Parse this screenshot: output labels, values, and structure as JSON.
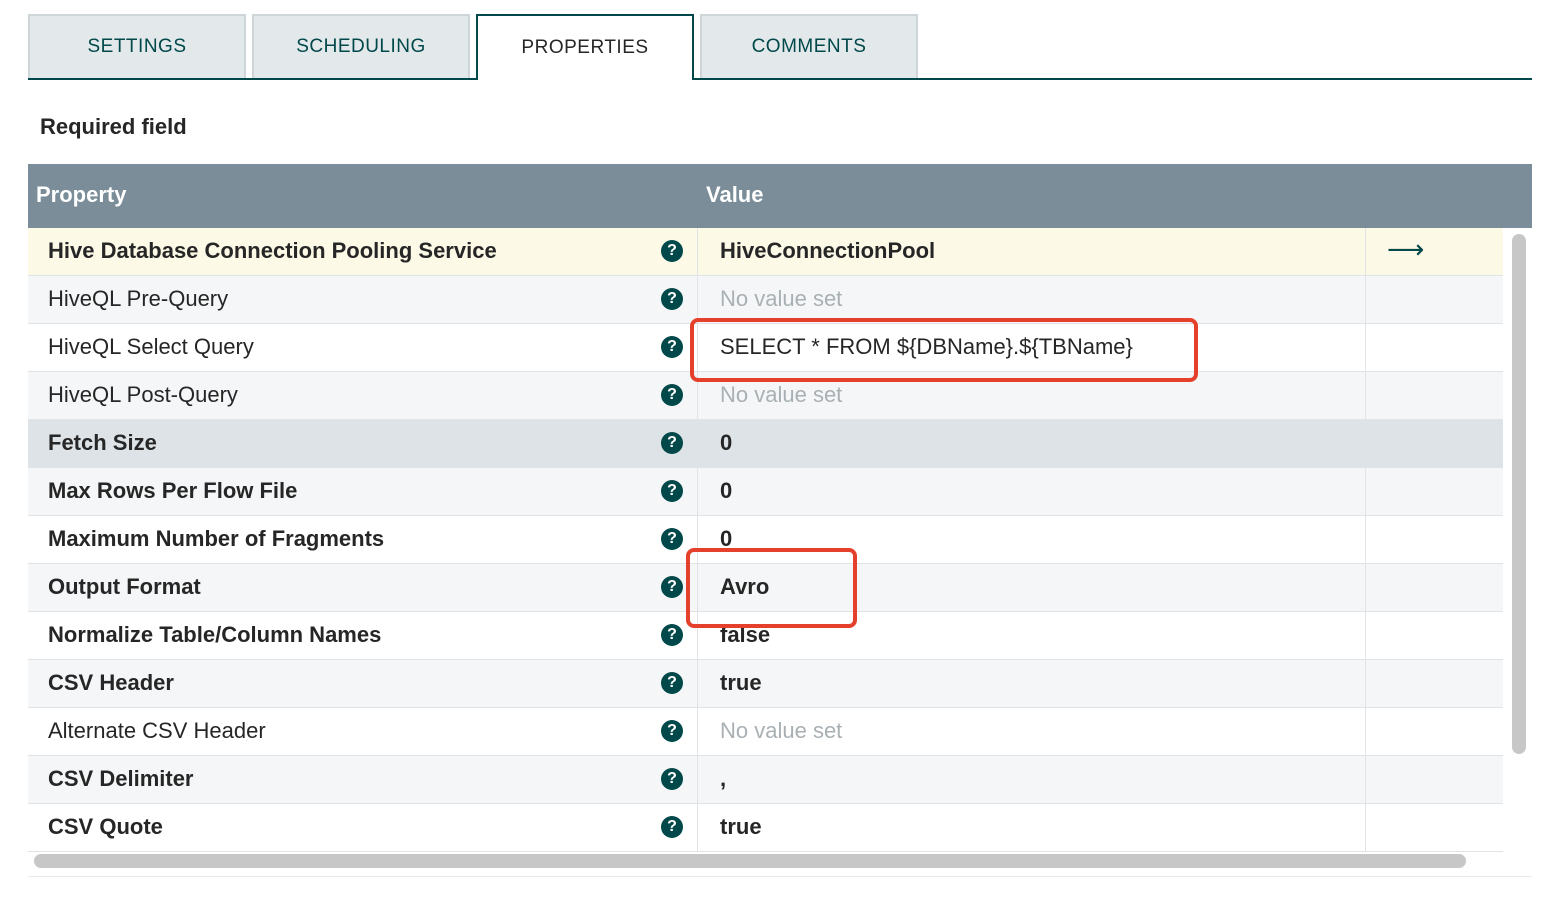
{
  "tabs": [
    {
      "label": "SETTINGS",
      "active": false
    },
    {
      "label": "SCHEDULING",
      "active": false
    },
    {
      "label": "PROPERTIES",
      "active": true
    },
    {
      "label": "COMMENTS",
      "active": false
    }
  ],
  "required_field_label": "Required field",
  "table": {
    "headers": {
      "property": "Property",
      "value": "Value"
    },
    "help_glyph": "?",
    "goto_glyph": "⟶",
    "rows": [
      {
        "property": "Hive Database Connection Pooling Service",
        "value": "HiveConnectionPool",
        "required": true,
        "value_set": true,
        "has_goto": true
      },
      {
        "property": "HiveQL Pre-Query",
        "value": "No value set",
        "required": false,
        "value_set": false
      },
      {
        "property": "HiveQL Select Query",
        "value": "SELECT * FROM ${DBName}.${TBName}",
        "required": false,
        "value_set": true
      },
      {
        "property": "HiveQL Post-Query",
        "value": "No value set",
        "required": false,
        "value_set": false
      },
      {
        "property": "Fetch Size",
        "value": "0",
        "required": true,
        "value_set": true
      },
      {
        "property": "Max Rows Per Flow File",
        "value": "0",
        "required": true,
        "value_set": true
      },
      {
        "property": "Maximum Number of Fragments",
        "value": "0",
        "required": true,
        "value_set": true
      },
      {
        "property": "Output Format",
        "value": "Avro",
        "required": true,
        "value_set": true
      },
      {
        "property": "Normalize Table/Column Names",
        "value": "false",
        "required": true,
        "value_set": true
      },
      {
        "property": "CSV Header",
        "value": "true",
        "required": true,
        "value_set": true
      },
      {
        "property": "Alternate CSV Header",
        "value": "No value set",
        "required": false,
        "value_set": false
      },
      {
        "property": "CSV Delimiter",
        "value": ",",
        "required": true,
        "value_set": true
      },
      {
        "property": "CSV Quote",
        "value": "true",
        "required": true,
        "value_set": true
      }
    ]
  },
  "colors": {
    "accent": "#004849",
    "header_bg": "#7a8d99",
    "annotation": "#e5402c",
    "first_row_bg": "#fcf9e7",
    "highlight_row_bg": "#dde3e6"
  }
}
